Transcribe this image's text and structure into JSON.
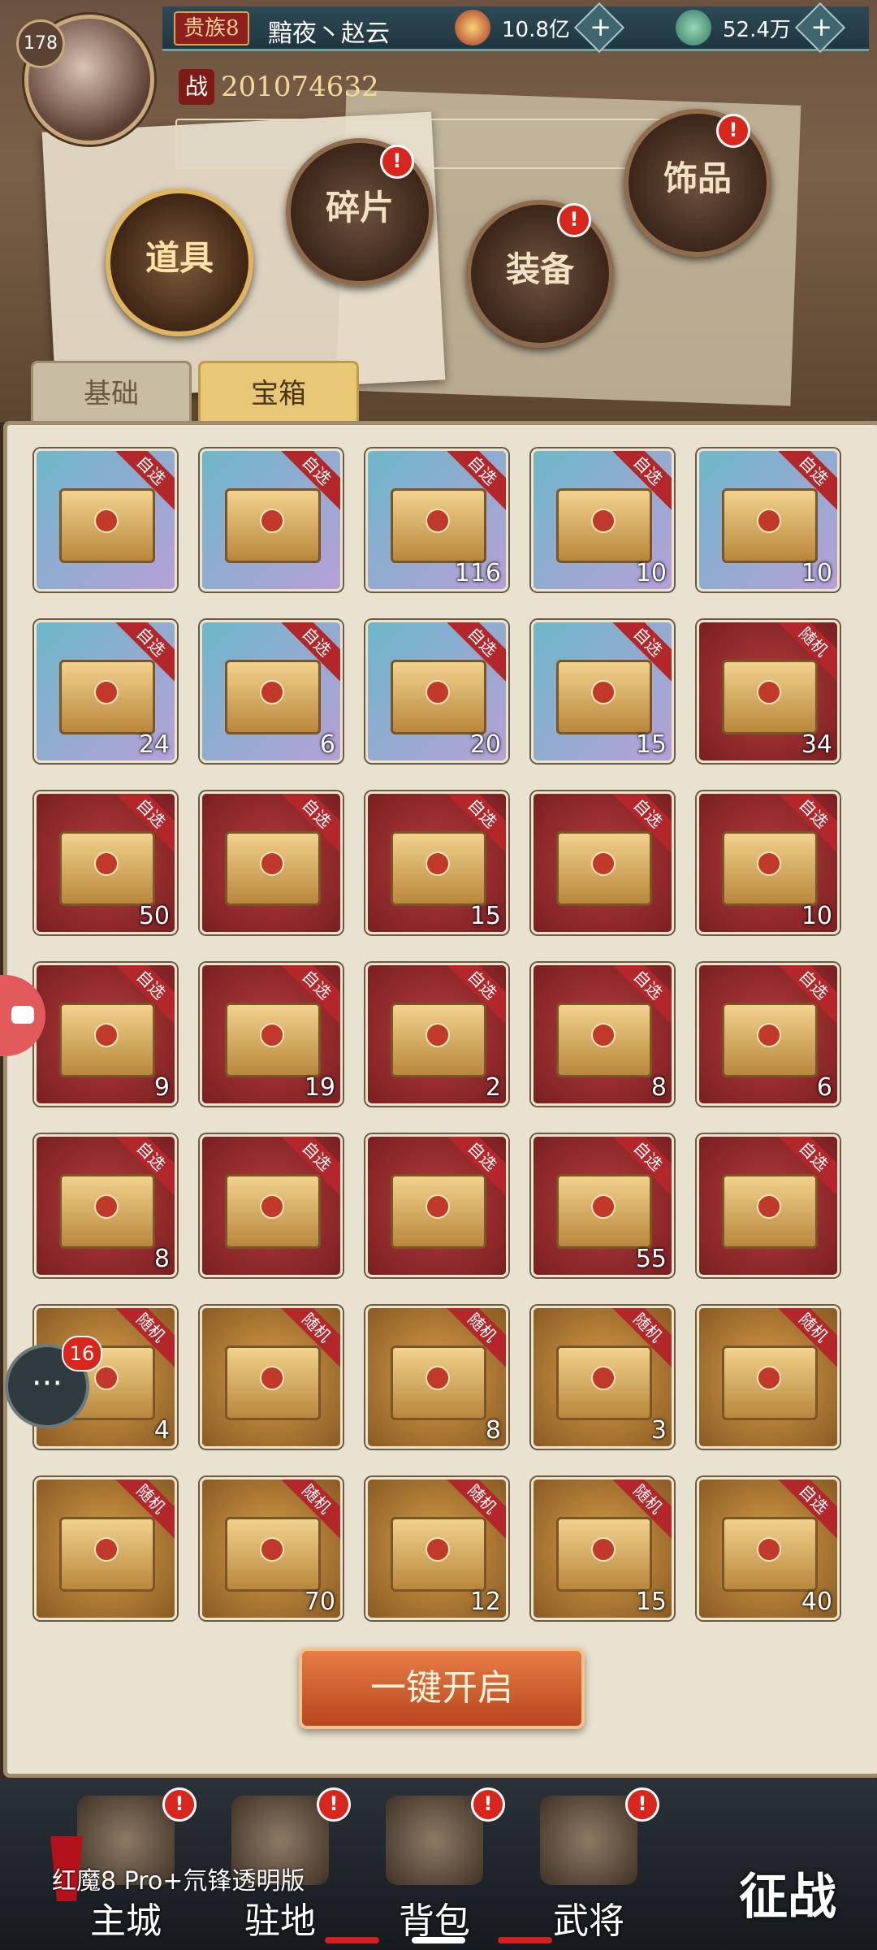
{
  "header": {
    "level": "178",
    "rank": "贵族8",
    "player_name": "黯夜丶赵云",
    "resource_gold": "10.8亿",
    "resource_jade": "52.4万",
    "plus": "+",
    "power_label": "战",
    "power_value": "201074632"
  },
  "categories": [
    {
      "label": "道具"
    },
    {
      "label": "碎片"
    },
    {
      "label": "装备"
    },
    {
      "label": "饰品"
    }
  ],
  "tabs": [
    {
      "label": "基础"
    },
    {
      "label": "宝箱"
    }
  ],
  "items": [
    {
      "tag": "自选",
      "count": "",
      "bg": "blue"
    },
    {
      "tag": "自选",
      "count": "",
      "bg": "blue"
    },
    {
      "tag": "自选",
      "count": "116",
      "bg": "blue"
    },
    {
      "tag": "自选",
      "count": "10",
      "bg": "blue"
    },
    {
      "tag": "自选",
      "count": "10",
      "bg": "blue"
    },
    {
      "tag": "自选",
      "count": "24",
      "bg": "blue"
    },
    {
      "tag": "自选",
      "count": "6",
      "bg": "blue"
    },
    {
      "tag": "自选",
      "count": "20",
      "bg": "blue"
    },
    {
      "tag": "自选",
      "count": "15",
      "bg": "blue"
    },
    {
      "tag": "随机",
      "count": "34",
      "bg": "red"
    },
    {
      "tag": "自选",
      "count": "50",
      "bg": "red"
    },
    {
      "tag": "自选",
      "count": "",
      "bg": "red"
    },
    {
      "tag": "自选",
      "count": "15",
      "bg": "red"
    },
    {
      "tag": "自选",
      "count": "",
      "bg": "red"
    },
    {
      "tag": "自选",
      "count": "10",
      "bg": "red"
    },
    {
      "tag": "自选",
      "count": "9",
      "bg": "red"
    },
    {
      "tag": "自选",
      "count": "19",
      "bg": "red"
    },
    {
      "tag": "自选",
      "count": "2",
      "bg": "red"
    },
    {
      "tag": "自选",
      "count": "8",
      "bg": "red"
    },
    {
      "tag": "自选",
      "count": "6",
      "bg": "red"
    },
    {
      "tag": "自选",
      "count": "8",
      "bg": "red"
    },
    {
      "tag": "自选",
      "count": "",
      "bg": "red"
    },
    {
      "tag": "自选",
      "count": "",
      "bg": "red"
    },
    {
      "tag": "自选",
      "count": "55",
      "bg": "red"
    },
    {
      "tag": "自选",
      "count": "",
      "bg": "red"
    },
    {
      "tag": "随机",
      "count": "4",
      "bg": "gold"
    },
    {
      "tag": "随机",
      "count": "",
      "bg": "gold"
    },
    {
      "tag": "随机",
      "count": "8",
      "bg": "gold"
    },
    {
      "tag": "随机",
      "count": "3",
      "bg": "gold"
    },
    {
      "tag": "随机",
      "count": "",
      "bg": "gold"
    },
    {
      "tag": "随机",
      "count": "",
      "bg": "gold"
    },
    {
      "tag": "随机",
      "count": "70",
      "bg": "gold"
    },
    {
      "tag": "随机",
      "count": "12",
      "bg": "gold"
    },
    {
      "tag": "随机",
      "count": "15",
      "bg": "gold"
    },
    {
      "tag": "自选",
      "count": "40",
      "bg": "gold"
    }
  ],
  "open_all_button": "一键开启",
  "chat_badge": "16",
  "alert_mark": "!",
  "bottom_nav": [
    {
      "label": "主城"
    },
    {
      "label": "驻地"
    },
    {
      "label": "背包"
    },
    {
      "label": "武将"
    }
  ],
  "conquer_label": "征战",
  "watermark": "红魔8 Pro+氘锋透明版",
  "colors": {
    "accent_red": "#d9261c",
    "tab_active": "#e8c877",
    "open_button": "#e67d45"
  }
}
